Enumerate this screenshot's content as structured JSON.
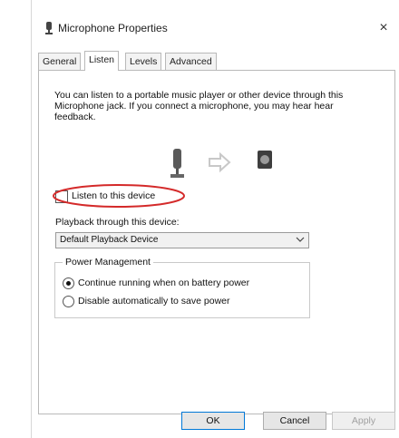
{
  "window": {
    "title": "Microphone Properties",
    "close_glyph": "×"
  },
  "tabs": [
    {
      "label": "General"
    },
    {
      "label": "Listen"
    },
    {
      "label": "Levels"
    },
    {
      "label": "Advanced"
    }
  ],
  "listen": {
    "description": "You can listen to a portable music player or other device through this Microphone jack. If you connect a microphone, you may hear hear feedback.",
    "listen_checkbox_label": "Listen to this device",
    "listen_checked": false,
    "playback_label": "Playback through this device:",
    "playback_selected": "Default Playback Device"
  },
  "power": {
    "legend": "Power Management",
    "option_continue": "Continue running when on battery power",
    "option_disable": "Disable automatically to save power",
    "selected": "continue"
  },
  "buttons": {
    "ok": "OK",
    "cancel": "Cancel",
    "apply": "Apply"
  },
  "colors": {
    "highlight_ring": "#d42a2a",
    "ok_border": "#0078d7"
  }
}
